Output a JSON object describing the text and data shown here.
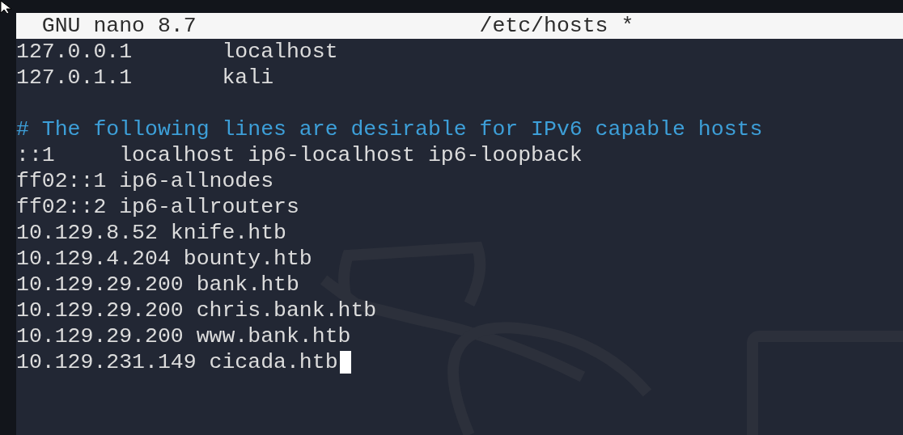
{
  "title_bar": {
    "app": "GNU nano 8.7",
    "file": "/etc/hosts *"
  },
  "lines": [
    {
      "kind": "text",
      "text": "127.0.0.1       localhost",
      "cursor": false
    },
    {
      "kind": "text",
      "text": "127.0.1.1       kali",
      "cursor": false
    },
    {
      "kind": "blank"
    },
    {
      "kind": "comment",
      "text": "# The following lines are desirable for IPv6 capable hosts",
      "cursor": false
    },
    {
      "kind": "text",
      "text": "::1     localhost ip6-localhost ip6-loopback",
      "cursor": false
    },
    {
      "kind": "text",
      "text": "ff02::1 ip6-allnodes",
      "cursor": false
    },
    {
      "kind": "text",
      "text": "ff02::2 ip6-allrouters",
      "cursor": false
    },
    {
      "kind": "text",
      "text": "10.129.8.52 knife.htb",
      "cursor": false
    },
    {
      "kind": "text",
      "text": "10.129.4.204 bounty.htb",
      "cursor": false
    },
    {
      "kind": "text",
      "text": "10.129.29.200 bank.htb",
      "cursor": false
    },
    {
      "kind": "text",
      "text": "10.129.29.200 chris.bank.htb",
      "cursor": false
    },
    {
      "kind": "text",
      "text": "10.129.29.200 www.bank.htb",
      "cursor": false
    },
    {
      "kind": "text",
      "text": "10.129.231.149 cicada.htb",
      "cursor": true
    }
  ]
}
